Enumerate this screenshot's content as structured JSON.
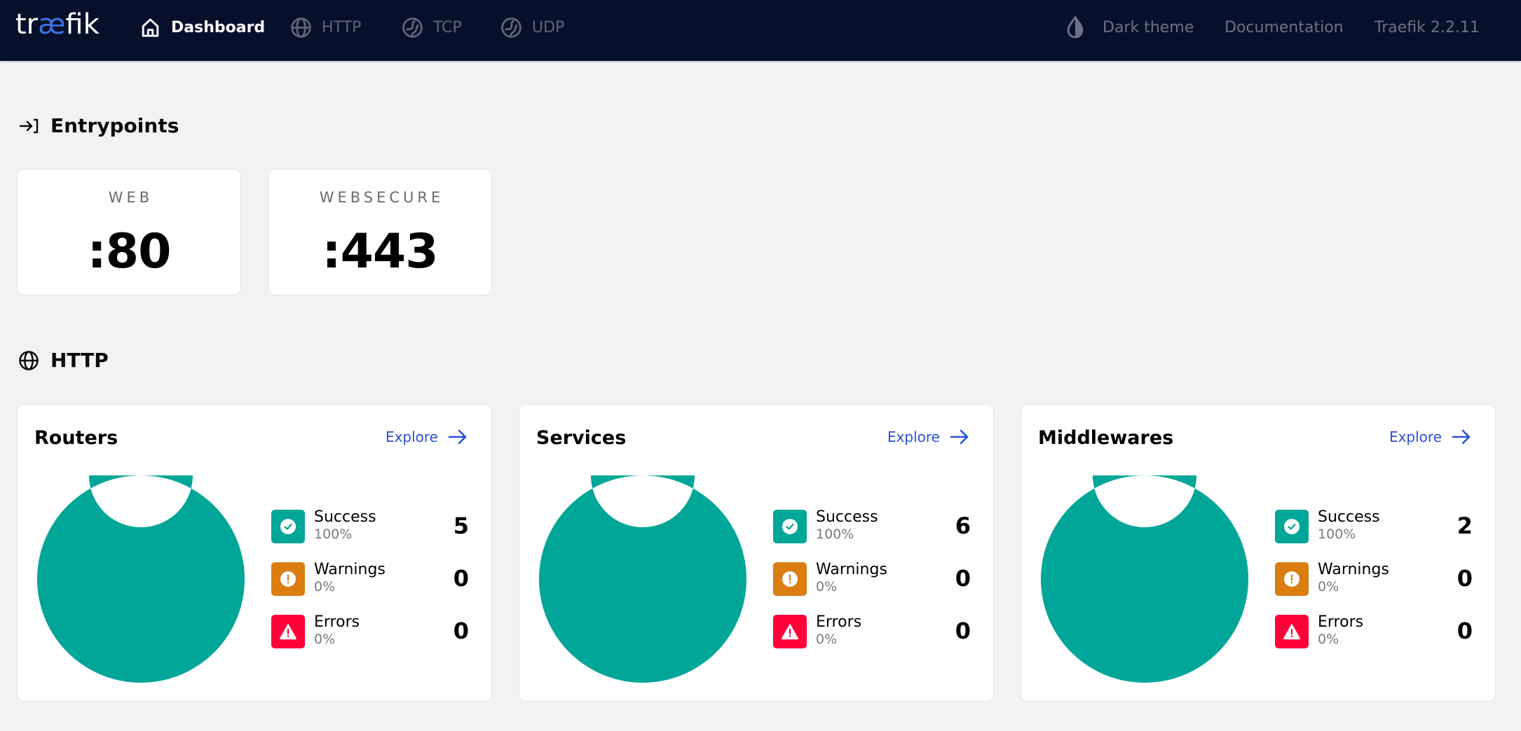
{
  "header": {
    "logo": {
      "pre": "tr",
      "ae": "æ",
      "post": "fik"
    },
    "nav": [
      {
        "label": "Dashboard",
        "icon": "home-icon",
        "active": true
      },
      {
        "label": "HTTP",
        "icon": "globe-icon",
        "active": false
      },
      {
        "label": "TCP",
        "icon": "tcp-icon",
        "active": false
      },
      {
        "label": "UDP",
        "icon": "udp-icon",
        "active": false
      }
    ],
    "theme_toggle": {
      "label": "Dark theme",
      "icon": "drop-icon"
    },
    "documentation": "Documentation",
    "version": "Traefik 2.2.11"
  },
  "entrypoints": {
    "title": "Entrypoints",
    "icon": "login-arrow-icon",
    "items": [
      {
        "name": "WEB",
        "port": ":80"
      },
      {
        "name": "WEBSECURE",
        "port": ":443"
      }
    ]
  },
  "http": {
    "title": "HTTP",
    "icon": "globe-icon",
    "explore_label": "Explore",
    "cards": [
      {
        "title": "Routers",
        "stats": [
          {
            "label": "Success",
            "percent": "100%",
            "count": "5"
          },
          {
            "label": "Warnings",
            "percent": "0%",
            "count": "0"
          },
          {
            "label": "Errors",
            "percent": "0%",
            "count": "0"
          }
        ]
      },
      {
        "title": "Services",
        "stats": [
          {
            "label": "Success",
            "percent": "100%",
            "count": "6"
          },
          {
            "label": "Warnings",
            "percent": "0%",
            "count": "0"
          },
          {
            "label": "Errors",
            "percent": "0%",
            "count": "0"
          }
        ]
      },
      {
        "title": "Middlewares",
        "stats": [
          {
            "label": "Success",
            "percent": "100%",
            "count": "2"
          },
          {
            "label": "Warnings",
            "percent": "0%",
            "count": "0"
          },
          {
            "label": "Errors",
            "percent": "0%",
            "count": "0"
          }
        ]
      }
    ]
  },
  "colors": {
    "success": "#00a697",
    "warning": "#db7d11",
    "error": "#ff0039",
    "accent": "#2e50d4",
    "header_bg": "#06102b"
  }
}
